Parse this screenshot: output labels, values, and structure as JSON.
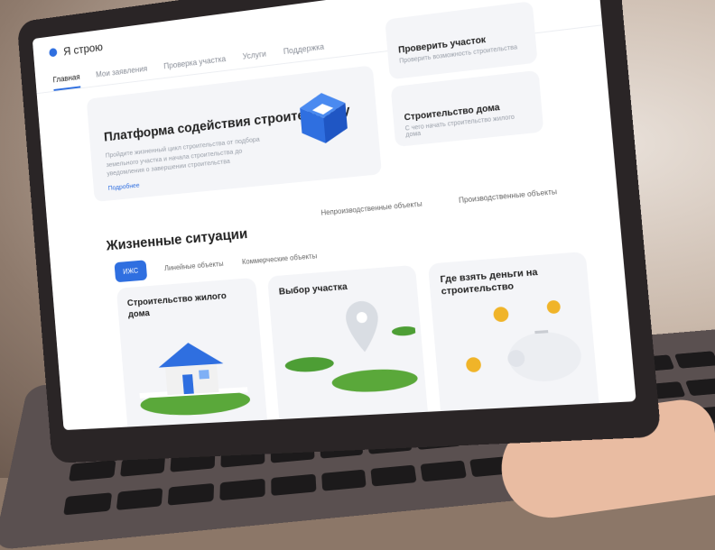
{
  "app": {
    "logo_text": "Я строю"
  },
  "nav": {
    "items": [
      "Главная",
      "Мои заявления",
      "Проверка участка",
      "Услуги",
      "Поддержка"
    ],
    "active": 0
  },
  "hero": {
    "title": "Платформа содействия строительству",
    "description": "Пройдите жизненный цикл строительства от подбора земельного участка и начала строительства до уведомления о завершении строительства",
    "link": "Подробнее",
    "icon": "box-icon"
  },
  "side_cards": [
    {
      "title": "Проверить участок",
      "subtitle": "Проверить возможность строительства"
    },
    {
      "title": "Строительство дома",
      "subtitle": "С чего начать строительство жилого дома"
    }
  ],
  "situations": {
    "title": "Жизненные ситуации",
    "tabs": [
      "ИЖС",
      "Линейные объекты",
      "Коммерческие объекты",
      "Непроизводственные объекты",
      "Производственные объекты"
    ],
    "active_tab": 0,
    "cards": [
      {
        "title": "Строительство жилого дома",
        "icon": "house-icon"
      },
      {
        "title": "Выбор участка",
        "icon": "location-pin-icon"
      },
      {
        "title": "Где взять деньги на строительство",
        "icon": "piggy-bank-icon"
      }
    ]
  },
  "colors": {
    "accent": "#2f6fe0",
    "card_bg": "#f4f5f8",
    "laptop": "#2a2526"
  }
}
